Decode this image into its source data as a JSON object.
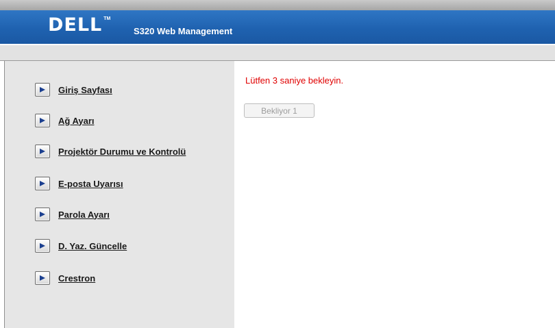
{
  "header": {
    "logo_text": "DELL",
    "logo_tm": "TM",
    "title": "S320 Web Management"
  },
  "sidebar": {
    "items": [
      {
        "label": "Giriş Sayfası",
        "icon": "arrow-right-icon"
      },
      {
        "label": "Ağ Ayarı",
        "icon": "arrow-right-icon"
      },
      {
        "label": "Projektör Durumu ve Kontrolü",
        "icon": "arrow-right-icon"
      },
      {
        "label": "E-posta Uyarısı",
        "icon": "arrow-right-icon"
      },
      {
        "label": "Parola Ayarı",
        "icon": "arrow-right-icon"
      },
      {
        "label": "D. Yaz. Güncelle",
        "icon": "arrow-right-icon"
      },
      {
        "label": "Crestron",
        "icon": "arrow-right-icon"
      }
    ]
  },
  "main": {
    "message": "Lütfen 3 saniye bekleyin.",
    "waiting_button_label": "Bekliyor 1"
  },
  "colors": {
    "header_blue": "#1f62b0",
    "message_red": "#e00000",
    "sidebar_gray": "#e6e6e6"
  }
}
